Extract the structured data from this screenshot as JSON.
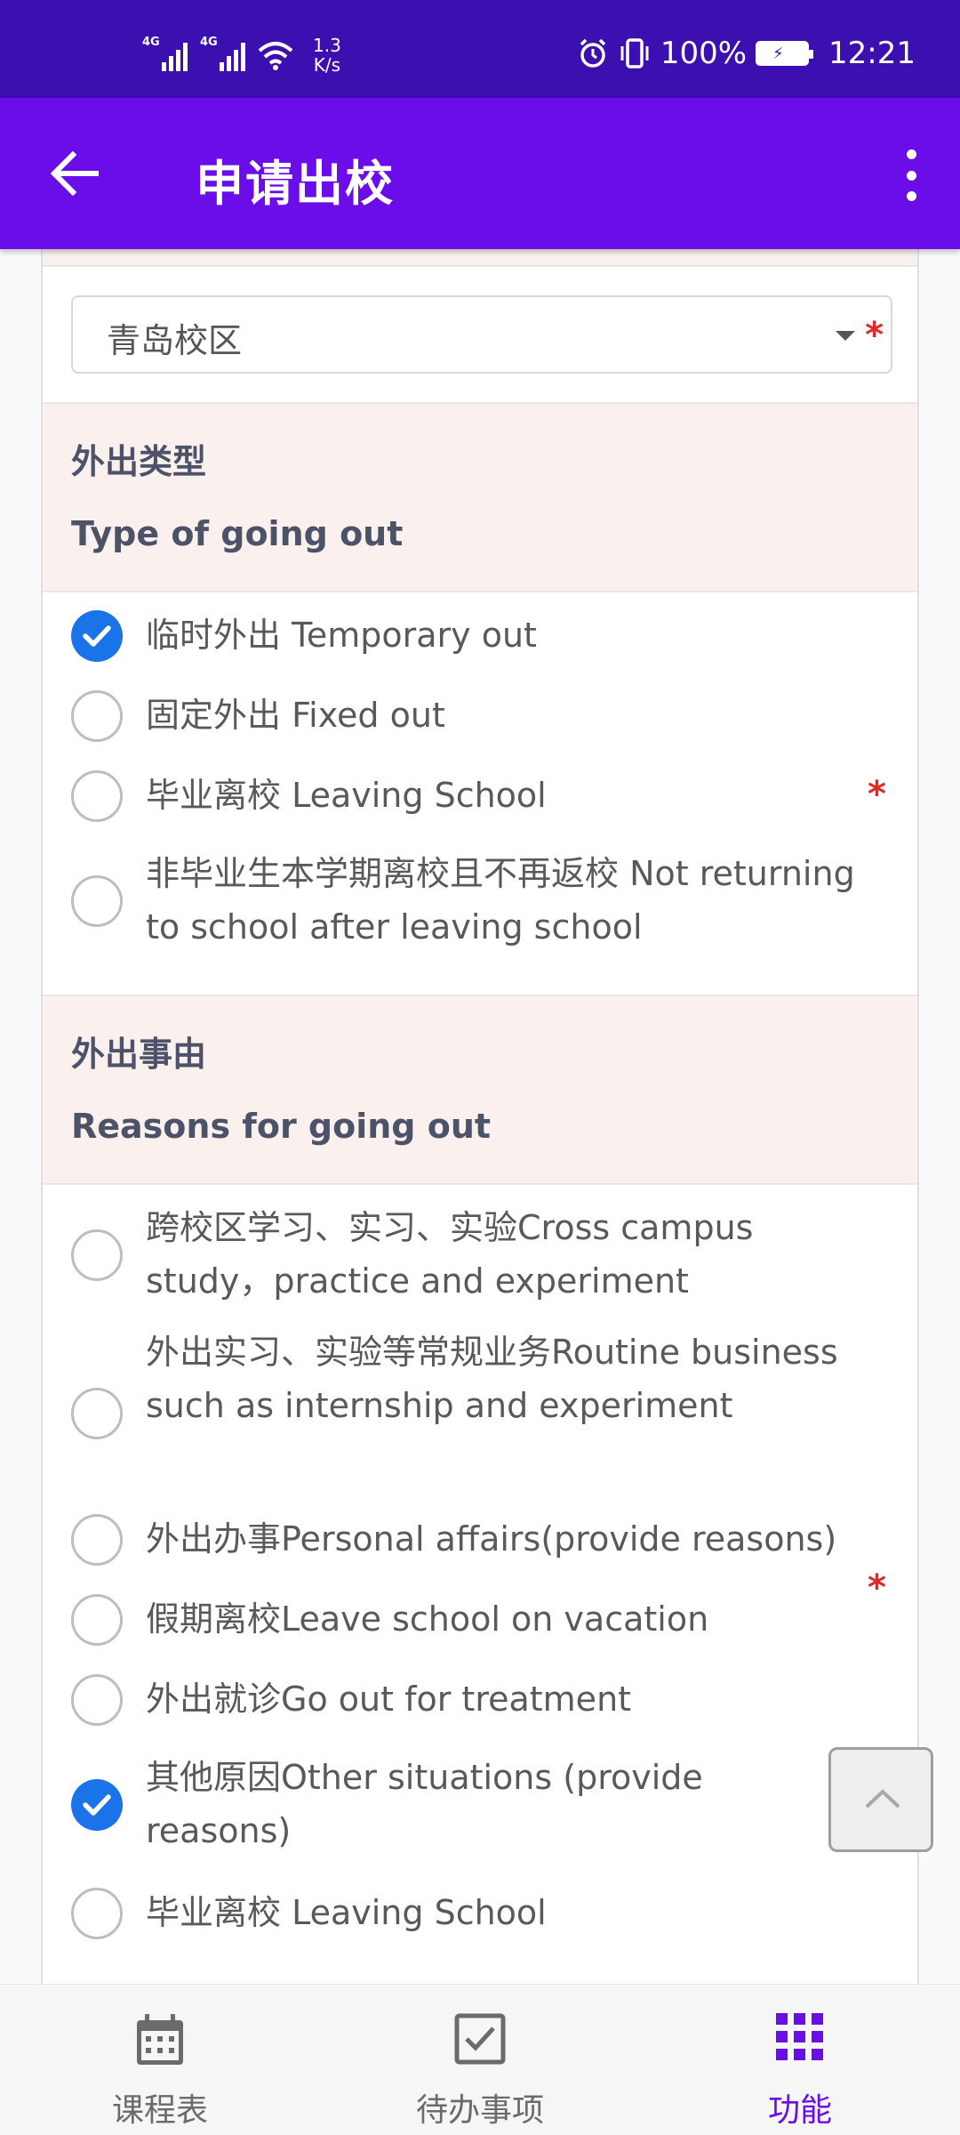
{
  "status_bar": {
    "net1": "4G",
    "net2": "4G",
    "speed": "1.3",
    "speed_unit": "K/s",
    "battery_pct": "100%",
    "time": "12:21"
  },
  "app_bar": {
    "title": "申请出校"
  },
  "campus_select": {
    "value": "青岛校区"
  },
  "section_type": {
    "title_zh": "外出类型",
    "title_en": "Type of going out",
    "options": [
      {
        "label": "临时外出 Temporary out",
        "checked": true
      },
      {
        "label": "固定外出 Fixed out",
        "checked": false
      },
      {
        "label": "毕业离校 Leaving School",
        "checked": false
      },
      {
        "label": "非毕业生本学期离校且不再返校 Not returning to school after leaving school",
        "checked": false
      }
    ]
  },
  "section_reason": {
    "title_zh": "外出事由",
    "title_en": "Reasons for going out",
    "options": [
      {
        "label": "跨校区学习、实习、实验Cross campus study，practice and experiment",
        "checked": false
      },
      {
        "label": "外出实习、实验等常规业务Routine business such as internship and experiment",
        "checked": false
      },
      {
        "label": "外出办事Personal affairs(provide reasons)",
        "checked": false
      },
      {
        "label": "假期离校Leave school on vacation",
        "checked": false
      },
      {
        "label": "外出就诊Go out for treatment",
        "checked": false
      },
      {
        "label": "其他原因Other situations (provide reasons)",
        "checked": true
      },
      {
        "label": "毕业离校 Leaving School",
        "checked": false
      }
    ]
  },
  "required_mark": "*",
  "bottom_nav": {
    "items": [
      {
        "label": "课程表",
        "icon": "calendar-icon",
        "active": false
      },
      {
        "label": "待办事项",
        "icon": "checkbox-icon",
        "active": false
      },
      {
        "label": "功能",
        "icon": "grid-icon",
        "active": true
      }
    ]
  },
  "colors": {
    "status_bar": "#3c0fb0",
    "app_bar": "#6a0de8",
    "checked_radio": "#1a73e8",
    "required": "#e42626",
    "section_bg": "#faf0ee"
  }
}
